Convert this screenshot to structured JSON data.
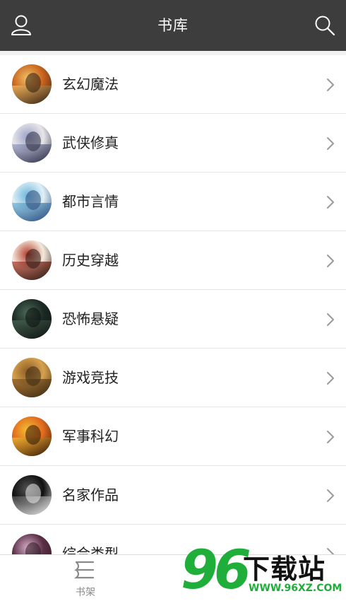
{
  "header": {
    "title": "书库",
    "left_icon": "user-icon",
    "right_icon": "search-icon"
  },
  "categories": [
    {
      "label": "玄幻魔法",
      "cover_colors": [
        "#c8621c",
        "#f0c46a",
        "#2a1a10"
      ]
    },
    {
      "label": "武侠修真",
      "cover_colors": [
        "#e8e6ea",
        "#9aa0c8",
        "#2c2c40"
      ]
    },
    {
      "label": "都市言情",
      "cover_colors": [
        "#dff0f7",
        "#6bb4d8",
        "#2d4a7a"
      ]
    },
    {
      "label": "历史穿越",
      "cover_colors": [
        "#f4e9dc",
        "#b33a2a",
        "#2a1b14"
      ]
    },
    {
      "label": "恐怖悬疑",
      "cover_colors": [
        "#1b2a24",
        "#4d6a5a",
        "#0a0f0c"
      ]
    },
    {
      "label": "游戏竞技",
      "cover_colors": [
        "#d7a24e",
        "#8a5a24",
        "#3a2a14"
      ]
    },
    {
      "label": "军事科幻",
      "cover_colors": [
        "#e06a1e",
        "#f5c032",
        "#2b1208"
      ]
    },
    {
      "label": "名家作品",
      "cover_colors": [
        "#111111",
        "#555555",
        "#e9e9e9"
      ]
    },
    {
      "label": "综合类型",
      "cover_colors": [
        "#5b2f46",
        "#d6b0c8",
        "#2a1420"
      ]
    }
  ],
  "bottom_nav": {
    "shelf_label": "书架",
    "shelf_icon": "bookshelf-icon"
  },
  "watermark": {
    "number": "96",
    "brand": "下载站",
    "url": "WWW.96XZ.COM"
  },
  "colors": {
    "header_bg": "#3d3d3d",
    "accent_green": "#1fae3a"
  }
}
